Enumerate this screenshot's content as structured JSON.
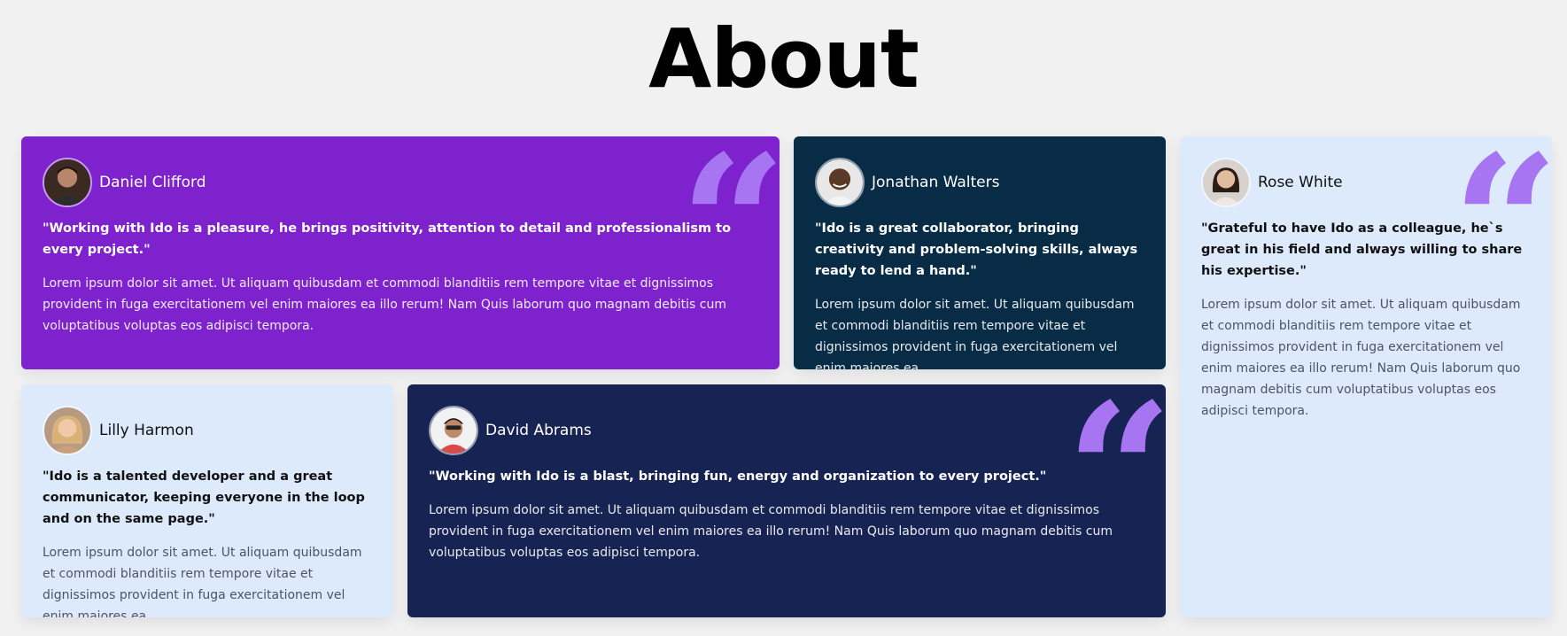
{
  "title": "About",
  "colors": {
    "background": "#f1f1f1",
    "purple": "#7e22ce",
    "dark_teal": "#082c45",
    "light": "#dceafc",
    "navy": "#172453",
    "quote_mark": "#a775f1"
  },
  "testimonials": [
    {
      "name": "Daniel Clifford",
      "avatar_icon": "avatar-daniel",
      "headline": "\"Working with Ido is a pleasure, he brings positivity, attention to detail and professionalism to every project.\"",
      "body": "Lorem ipsum dolor sit amet. Ut aliquam quibusdam et commodi blanditiis rem tempore vitae et dignissimos provident in fuga exercitationem vel enim maiores ea illo rerum! Nam Quis laborum quo magnam debitis cum voluptatibus voluptas eos adipisci tempora.",
      "quote_glyph": "“"
    },
    {
      "name": "Jonathan Walters",
      "avatar_icon": "avatar-jonathan",
      "headline": "\"Ido is a great collaborator, bringing creativity and problem-solving skills, always ready to lend a hand.\"",
      "body": "Lorem ipsum dolor sit amet. Ut aliquam quibusdam et commodi blanditiis rem tempore vitae et dignissimos provident in fuga exercitationem vel enim maiores ea"
    },
    {
      "name": "Rose White",
      "avatar_icon": "avatar-rose",
      "headline": "\"Grateful to have Ido as a colleague, he`s great in his field and always willing to share his expertise.\"",
      "body": "Lorem ipsum dolor sit amet. Ut aliquam quibusdam et commodi blanditiis rem tempore vitae et dignissimos provident in fuga exercitationem vel enim maiores ea illo rerum! Nam Quis laborum quo magnam debitis cum voluptatibus voluptas eos adipisci tempora.",
      "quote_glyph": "“"
    },
    {
      "name": "Lilly Harmon",
      "avatar_icon": "avatar-lilly",
      "headline": "\"Ido is a talented developer and a great communicator, keeping everyone in the loop and on the same page.\"",
      "body": "Lorem ipsum dolor sit amet. Ut aliquam quibusdam et commodi blanditiis rem tempore vitae et dignissimos provident in fuga exercitationem vel enim maiores ea"
    },
    {
      "name": "David Abrams",
      "avatar_icon": "avatar-david",
      "headline": "\"Working with Ido is a blast, bringing fun, energy and organization to every project.\"",
      "body": "Lorem ipsum dolor sit amet. Ut aliquam quibusdam et commodi blanditiis rem tempore vitae et dignissimos provident in fuga exercitationem vel enim maiores ea illo rerum! Nam Quis laborum quo magnam debitis cum voluptatibus voluptas eos adipisci tempora.",
      "quote_glyph": "“"
    }
  ]
}
